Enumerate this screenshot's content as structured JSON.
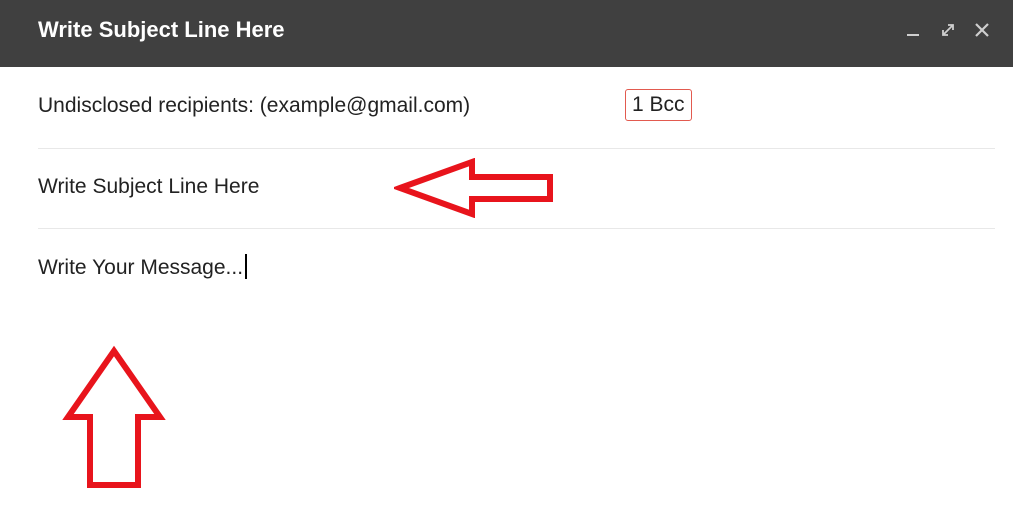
{
  "window": {
    "title": "Write Subject Line Here",
    "controls": {
      "minimize_icon": "minimize-icon",
      "expand_icon": "expand-icon",
      "close_icon": "close-icon"
    }
  },
  "recipients": {
    "text": "Undisclosed recipients: (example@gmail.com)",
    "bcc_badge": "1 Bcc"
  },
  "subject": {
    "value": "Write Subject Line Here"
  },
  "message": {
    "value": "Write Your Message..."
  },
  "annotations": {
    "arrow_color": "#e8141c",
    "arrows": [
      "left-arrow-pointing-at-subject",
      "up-arrow-pointing-at-message"
    ]
  },
  "colors": {
    "titlebar_bg": "#404040",
    "badge_border": "#e25a4f"
  }
}
